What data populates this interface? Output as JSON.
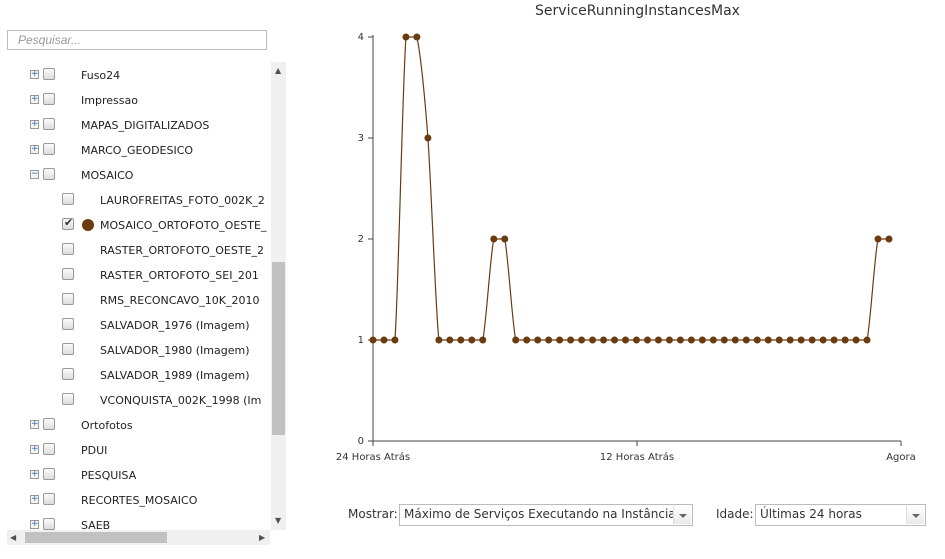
{
  "sidebar": {
    "search_placeholder": "Pesquisar...",
    "layers": [
      {
        "label": "Fuso24",
        "level": 0,
        "expander": "+",
        "checked": false
      },
      {
        "label": "Impressao",
        "level": 0,
        "expander": "+",
        "checked": false
      },
      {
        "label": "MAPAS_DIGITALIZADOS",
        "level": 0,
        "expander": "+",
        "checked": false
      },
      {
        "label": "MARCO_GEODESICO",
        "level": 0,
        "expander": "+",
        "checked": false
      },
      {
        "label": "MOSAICO",
        "level": 0,
        "expander": "−",
        "checked": false
      },
      {
        "label": "LAUROFREITAS_FOTO_002K_2",
        "level": 1,
        "checked": false
      },
      {
        "label": "MOSAICO_ORTOFOTO_OESTE_",
        "level": 1,
        "checked": true,
        "color": "#6b3b10"
      },
      {
        "label": "RASTER_ORTOFOTO_OESTE_2",
        "level": 1,
        "checked": false
      },
      {
        "label": "RASTER_ORTOFOTO_SEI_201",
        "level": 1,
        "checked": false
      },
      {
        "label": "RMS_RECONCAVO_10K_2010",
        "level": 1,
        "checked": false
      },
      {
        "label": "SALVADOR_1976 (Imagem)",
        "level": 1,
        "checked": false
      },
      {
        "label": "SALVADOR_1980 (Imagem)",
        "level": 1,
        "checked": false
      },
      {
        "label": "SALVADOR_1989 (Imagem)",
        "level": 1,
        "checked": false
      },
      {
        "label": "VCONQUISTA_002K_1998 (Im",
        "level": 1,
        "checked": false
      },
      {
        "label": "Ortofotos",
        "level": 0,
        "expander": "+",
        "checked": false
      },
      {
        "label": "PDUI",
        "level": 0,
        "expander": "+",
        "checked": false
      },
      {
        "label": "PESQUISA",
        "level": 0,
        "expander": "+",
        "checked": false
      },
      {
        "label": "RECORTES_MOSAICO",
        "level": 0,
        "expander": "+",
        "checked": false
      },
      {
        "label": "SAEB",
        "level": 0,
        "expander": "+",
        "checked": false
      }
    ]
  },
  "chart_data": {
    "type": "line",
    "title": "ServiceRunningInstancesMax",
    "x_tick_labels": [
      "24 Horas Atrás",
      "12 Horas Atrás",
      "Agora"
    ],
    "y_ticks": [
      0,
      1,
      2,
      3,
      4
    ],
    "ylim": [
      0,
      4
    ],
    "line_color": "#6b3b10",
    "series": [
      {
        "values": [
          1,
          1,
          1,
          4,
          4,
          3,
          1,
          1,
          1,
          1,
          1,
          2,
          2,
          1,
          1,
          1,
          1,
          1,
          1,
          1,
          1,
          1,
          1,
          1,
          1,
          1,
          1,
          1,
          1,
          1,
          1,
          1,
          1,
          1,
          1,
          1,
          1,
          1,
          1,
          1,
          1,
          1,
          1,
          1,
          1,
          1,
          2,
          2
        ]
      }
    ]
  },
  "controls": {
    "mostrar_label": "Mostrar:",
    "mostrar_value": "Máximo de Serviços Executando na Instância",
    "idade_label": "Idade:",
    "idade_value": "Últimas 24 horas"
  }
}
